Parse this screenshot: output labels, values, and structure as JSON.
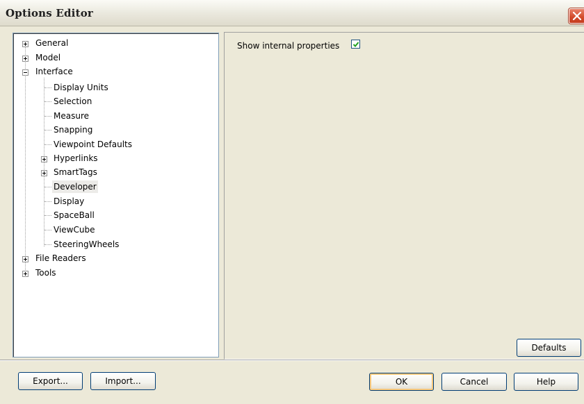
{
  "window": {
    "title": "Options Editor"
  },
  "tree": {
    "items": [
      {
        "label": "General",
        "expander": "plus"
      },
      {
        "label": "Model",
        "expander": "plus"
      },
      {
        "label": "Interface",
        "expander": "minus"
      },
      {
        "label": "Display Units"
      },
      {
        "label": "Selection"
      },
      {
        "label": "Measure"
      },
      {
        "label": "Snapping"
      },
      {
        "label": "Viewpoint Defaults"
      },
      {
        "label": "Hyperlinks",
        "expander": "plus"
      },
      {
        "label": "SmartTags",
        "expander": "plus"
      },
      {
        "label": "Developer",
        "selected": true
      },
      {
        "label": "Display"
      },
      {
        "label": "SpaceBall"
      },
      {
        "label": "ViewCube"
      },
      {
        "label": "SteeringWheels"
      },
      {
        "label": "File Readers",
        "expander": "plus"
      },
      {
        "label": "Tools",
        "expander": "plus"
      }
    ]
  },
  "developer": {
    "show_internal_label": "Show internal properties",
    "show_internal_checked": true
  },
  "buttons": {
    "defaults": "Defaults",
    "export": "Export...",
    "import": "Import...",
    "ok": "OK",
    "cancel": "Cancel",
    "help": "Help"
  },
  "colors": {
    "window_bg": "#ece9d8",
    "close_red": "#d24a2a",
    "checkmark": "#21a121",
    "button_border": "#003c74",
    "default_focus": "#f9c97c"
  },
  "icons": {
    "close": "close-icon",
    "expand": "plus-expander-icon",
    "collapse": "minus-expander-icon",
    "check": "check-icon"
  }
}
